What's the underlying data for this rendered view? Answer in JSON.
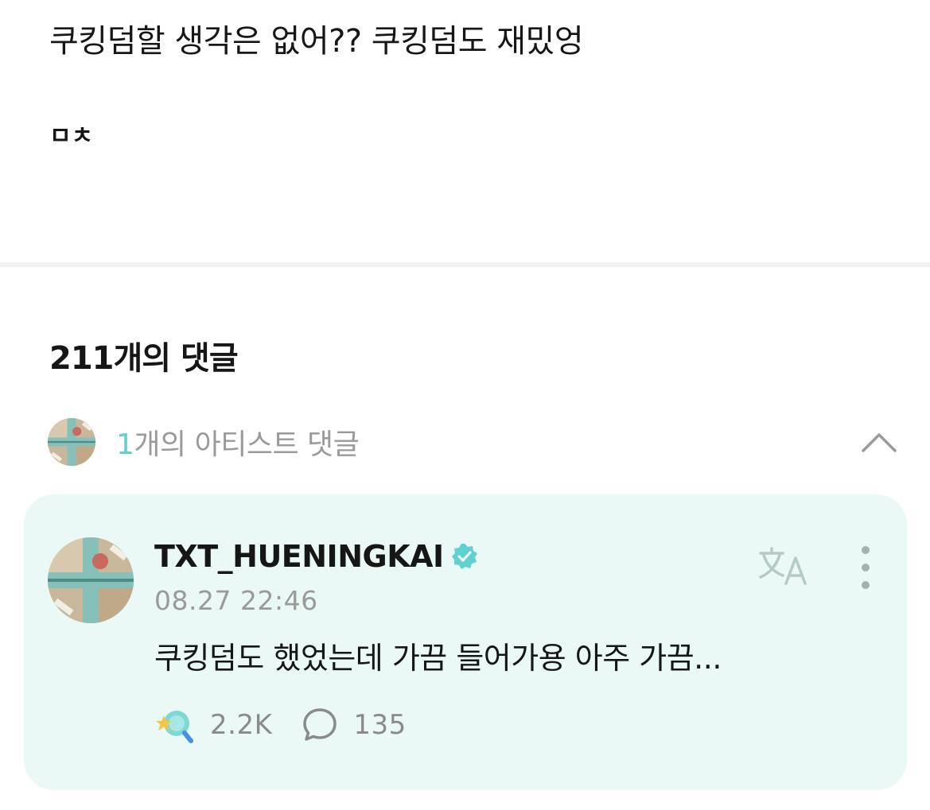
{
  "post": {
    "line1": "쿠킹덤할 생각은 없어?? 쿠킹덤도 재밌엉",
    "line2": "ㅁㅊ"
  },
  "comments": {
    "title": "211개의 댓글",
    "artist_bar": {
      "count": "1",
      "label": "개의 아티스트 댓글",
      "toggle_icon": "chevron-up-icon"
    }
  },
  "artist_comment": {
    "username": "TXT_HUENINGKAI",
    "verified_icon": "verified-badge-icon",
    "timestamp": "08.27 22:46",
    "text": "쿠킹덤도 했었는데 가끔 들어가용 아주 가끔...",
    "likes": "2.2K",
    "replies": "135",
    "like_icon": "star-lightstick-icon",
    "reply_icon": "speech-bubble-icon",
    "translate_icon": "translate-icon",
    "more_icon": "more-vertical-icon"
  },
  "colors": {
    "accent": "#5fd1d0",
    "card_bg": "#eaf8f6",
    "muted_text": "#9a9a9a",
    "divider": "#f1f1f3"
  }
}
